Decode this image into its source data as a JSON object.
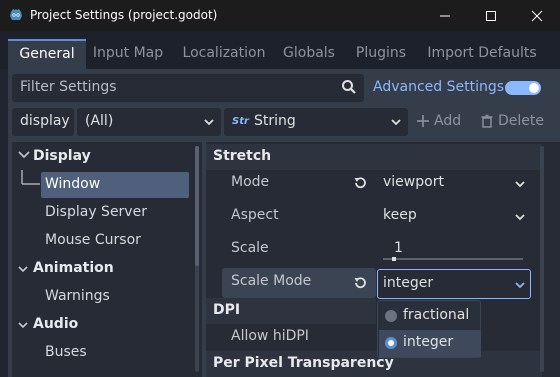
{
  "window": {
    "title": "Project Settings (project.godot)",
    "minimize_icon": "minimize-icon",
    "maximize_icon": "maximize-icon",
    "close_icon": "close-icon"
  },
  "tabs": [
    {
      "label": "General",
      "active": true
    },
    {
      "label": "Input Map"
    },
    {
      "label": "Localization"
    },
    {
      "label": "Globals"
    },
    {
      "label": "Plugins"
    },
    {
      "label": "Import Defaults"
    }
  ],
  "toolbar": {
    "filter_placeholder": "Filter Settings",
    "advanced_label": "Advanced Settings",
    "advanced_enabled": true,
    "path_value": "display",
    "feature_value": "(All)",
    "type_icon": "Str",
    "type_value": "String",
    "add_label": "Add",
    "delete_label": "Delete"
  },
  "tree": {
    "sections": {
      "display": "Display",
      "animation": "Animation",
      "audio": "Audio"
    },
    "items": {
      "window": "Window",
      "display_server": "Display Server",
      "mouse_cursor": "Mouse Cursor",
      "warnings": "Warnings",
      "buses": "Buses"
    },
    "selected": "Window"
  },
  "inspector": {
    "stretch_title": "Stretch",
    "mode_label": "Mode",
    "mode_value": "viewport",
    "aspect_label": "Aspect",
    "aspect_value": "keep",
    "scale_label": "Scale",
    "scale_value": "1",
    "scale_mode_label": "Scale Mode",
    "scale_mode_value": "integer",
    "dpi_title": "DPI",
    "allow_hidpi_label": "Allow hiDPI",
    "ppt_title": "Per Pixel Transparency"
  },
  "scale_mode_options": [
    {
      "label": "fractional",
      "selected": false
    },
    {
      "label": "integer",
      "selected": true
    }
  ],
  "colors": {
    "accent": "#8ab8ff",
    "panel": "#363d4a",
    "field": "#262b35"
  }
}
